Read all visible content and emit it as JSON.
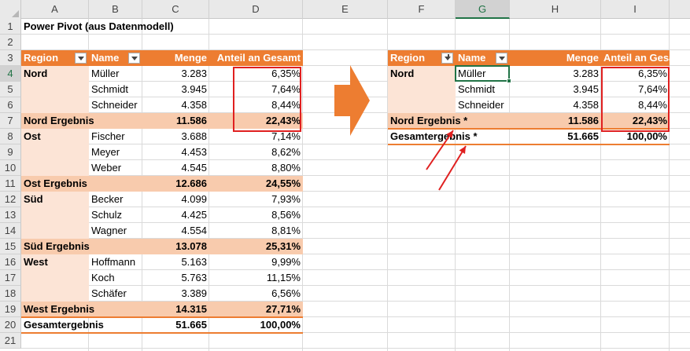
{
  "columns": [
    "A",
    "B",
    "C",
    "D",
    "E",
    "F",
    "G",
    "H",
    "I"
  ],
  "rows": [
    "1",
    "2",
    "3",
    "4",
    "5",
    "6",
    "7",
    "8",
    "9",
    "10",
    "11",
    "12",
    "13",
    "14",
    "15",
    "16",
    "17",
    "18",
    "19",
    "20",
    "21"
  ],
  "title": "Power Pivot (aus Datenmodell)",
  "left_pivot": {
    "headers": [
      "Region",
      "Name",
      "Menge",
      "Anteil  an Gesamt"
    ],
    "rows": [
      {
        "region": "Nord",
        "name": "Müller",
        "menge": "3.283",
        "anteil": "6,35%"
      },
      {
        "region": "",
        "name": "Schmidt",
        "menge": "3.945",
        "anteil": "7,64%"
      },
      {
        "region": "",
        "name": "Schneider",
        "menge": "4.358",
        "anteil": "8,44%"
      },
      {
        "subtotal": "Nord Ergebnis",
        "menge": "11.586",
        "anteil": "22,43%"
      },
      {
        "region": "Ost",
        "name": "Fischer",
        "menge": "3.688",
        "anteil": "7,14%"
      },
      {
        "region": "",
        "name": "Meyer",
        "menge": "4.453",
        "anteil": "8,62%"
      },
      {
        "region": "",
        "name": "Weber",
        "menge": "4.545",
        "anteil": "8,80%"
      },
      {
        "subtotal": "Ost Ergebnis",
        "menge": "12.686",
        "anteil": "24,55%"
      },
      {
        "region": "Süd",
        "name": "Becker",
        "menge": "4.099",
        "anteil": "7,93%"
      },
      {
        "region": "",
        "name": "Schulz",
        "menge": "4.425",
        "anteil": "8,56%"
      },
      {
        "region": "",
        "name": "Wagner",
        "menge": "4.554",
        "anteil": "8,81%"
      },
      {
        "subtotal": "Süd Ergebnis",
        "menge": "13.078",
        "anteil": "25,31%"
      },
      {
        "region": "West",
        "name": "Hoffmann",
        "menge": "5.163",
        "anteil": "9,99%"
      },
      {
        "region": "",
        "name": "Koch",
        "menge": "5.763",
        "anteil": "11,15%"
      },
      {
        "region": "",
        "name": "Schäfer",
        "menge": "3.389",
        "anteil": "6,56%"
      },
      {
        "subtotal": "West Ergebnis",
        "menge": "14.315",
        "anteil": "27,71%"
      },
      {
        "grand": "Gesamtergebnis",
        "menge": "51.665",
        "anteil": "100,00%"
      }
    ]
  },
  "right_pivot": {
    "headers": [
      "Region",
      "Name",
      "Menge",
      "Anteil  an Gesamt"
    ],
    "rows": [
      {
        "region": "Nord",
        "name": "Müller",
        "menge": "3.283",
        "anteil": "6,35%"
      },
      {
        "region": "",
        "name": "Schmidt",
        "menge": "3.945",
        "anteil": "7,64%"
      },
      {
        "region": "",
        "name": "Schneider",
        "menge": "4.358",
        "anteil": "8,44%"
      },
      {
        "subtotal": "Nord Ergebnis *",
        "menge": "11.586",
        "anteil": "22,43%"
      },
      {
        "grand": "Gesamtergebnis *",
        "menge": "51.665",
        "anteil": "100,00%"
      }
    ]
  },
  "colors": {
    "header_orange": "#ed7d31",
    "light_band": "#fce4d6",
    "subtotal_band": "#f8cbad",
    "selection_green": "#217346",
    "highlight_red": "#e02020"
  },
  "icons": [
    "filter-dropdown-icon",
    "filter-active-icon",
    "right-arrow-icon",
    "red-pointer-arrow-icon"
  ]
}
